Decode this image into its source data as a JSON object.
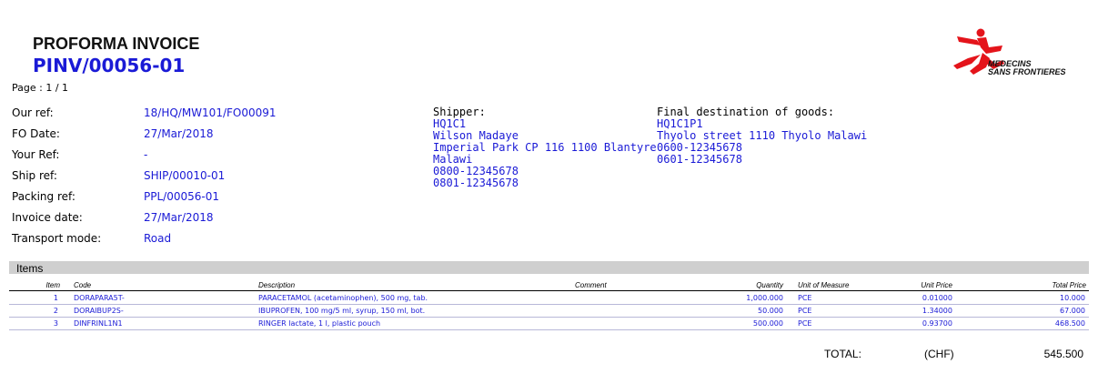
{
  "header": {
    "doc_type": "PROFORMA INVOICE",
    "doc_number": "PINV/00056-01",
    "page_indicator": "Page : 1 /   1"
  },
  "logo": {
    "line1": "MEDECINS",
    "line2": "SANS FRONTIERES",
    "icon": "msf-running-figure-logo"
  },
  "refs": [
    {
      "label": "Our ref:",
      "value": "18/HQ/MW101/FO00091"
    },
    {
      "label": "FO Date:",
      "value": "27/Mar/2018"
    },
    {
      "label": "Your Ref:",
      "value": "-"
    },
    {
      "label": "Ship ref:",
      "value": "SHIP/00010-01"
    },
    {
      "label": "Packing ref:",
      "value": "PPL/00056-01"
    },
    {
      "label": "Invoice date:",
      "value": "27/Mar/2018"
    },
    {
      "label": "Transport mode:",
      "value": "Road"
    }
  ],
  "shipper": {
    "label": "Shipper:",
    "lines": [
      "HQ1C1",
      "Wilson Madaye",
      "Imperial Park CP 116 1100 Blantyre",
      "Malawi",
      "0800-12345678",
      "0801-12345678"
    ]
  },
  "destination": {
    "label": "Final destination of goods:",
    "lines": [
      "HQ1C1P1",
      "Thyolo street 1110 Thyolo Malawi",
      "0600-12345678",
      "0601-12345678"
    ]
  },
  "items": {
    "title": "Items",
    "columns": {
      "item": "Item",
      "code": "Code",
      "description": "Description",
      "comment": "Comment",
      "quantity": "Quantity",
      "uom": "Unit of Measure",
      "unit_price": "Unit Price",
      "total_price": "Total Price"
    },
    "rows": [
      {
        "item": "1",
        "code": "DORAPARA5T-",
        "description": "PARACETAMOL (acetaminophen), 500 mg, tab.",
        "comment": "",
        "quantity": "1,000.000",
        "uom": "PCE",
        "unit_price": "0.01000",
        "total_price": "10.000"
      },
      {
        "item": "2",
        "code": "DORAIBUP2S-",
        "description": "IBUPROFEN, 100 mg/5 ml, syrup, 150 ml, bot.",
        "comment": "",
        "quantity": "50.000",
        "uom": "PCE",
        "unit_price": "1.34000",
        "total_price": "67.000"
      },
      {
        "item": "3",
        "code": "DINFRINL1N1",
        "description": "RINGER lactate, 1 l, plastic pouch",
        "comment": "",
        "quantity": "500.000",
        "uom": "PCE",
        "unit_price": "0.93700",
        "total_price": "468.500"
      }
    ]
  },
  "total": {
    "label": "TOTAL:",
    "currency": "(CHF)",
    "value": "545.500"
  }
}
